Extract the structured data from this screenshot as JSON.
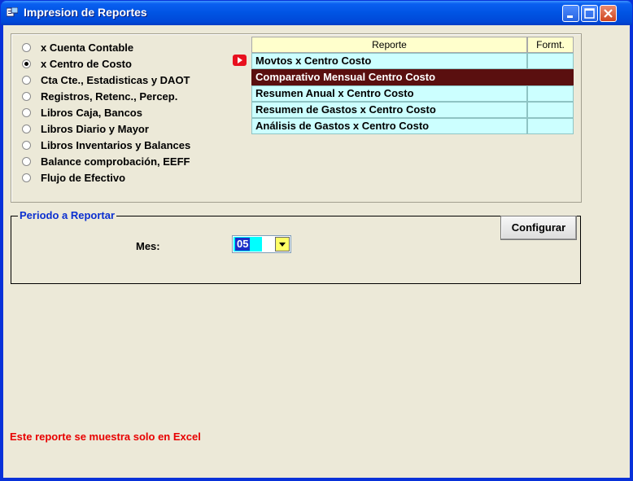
{
  "window": {
    "title": "Impresion de Reportes",
    "icon": "report-app-icon"
  },
  "report_types": [
    {
      "label": "x Cuenta Contable",
      "selected": false
    },
    {
      "label": "x Centro de Costo",
      "selected": true
    },
    {
      "label": "Cta Cte., Estadisticas y DAOT",
      "selected": false
    },
    {
      "label": "Registros, Retenc., Percep.",
      "selected": false
    },
    {
      "label": "Libros Caja, Bancos",
      "selected": false
    },
    {
      "label": "Libros Diario y Mayor",
      "selected": false
    },
    {
      "label": "Libros Inventarios y Balances",
      "selected": false
    },
    {
      "label": "Balance comprobación, EEFF",
      "selected": false
    },
    {
      "label": "Flujo de Efectivo",
      "selected": false
    }
  ],
  "grid": {
    "headers": [
      "Reporte",
      "Formt."
    ],
    "rows": [
      {
        "reporte": "Movtos x Centro Costo",
        "format": ""
      },
      {
        "reporte": "Comparativo Mensual Centro Costo",
        "format": ""
      },
      {
        "reporte": "Resumen Anual x Centro Costo",
        "format": ""
      },
      {
        "reporte": "Resumen de Gastos x Centro Costo",
        "format": ""
      },
      {
        "reporte": "Análisis de Gastos x Centro Costo",
        "format": ""
      }
    ],
    "selected_row": 1,
    "pointer_row": 0
  },
  "periodo": {
    "legend": "Periodo a Reportar",
    "mes_label": "Mes:",
    "mes_value": "05"
  },
  "configurar_label": "Configurar",
  "footer_message": "Este reporte se muestra solo en Excel",
  "colors": {
    "grid_header": "#ffffcc",
    "grid_row": "#ccffff",
    "grid_selected": "#5a0f0f",
    "legend_text": "#0b2fd0",
    "footer_text": "#e80000"
  }
}
